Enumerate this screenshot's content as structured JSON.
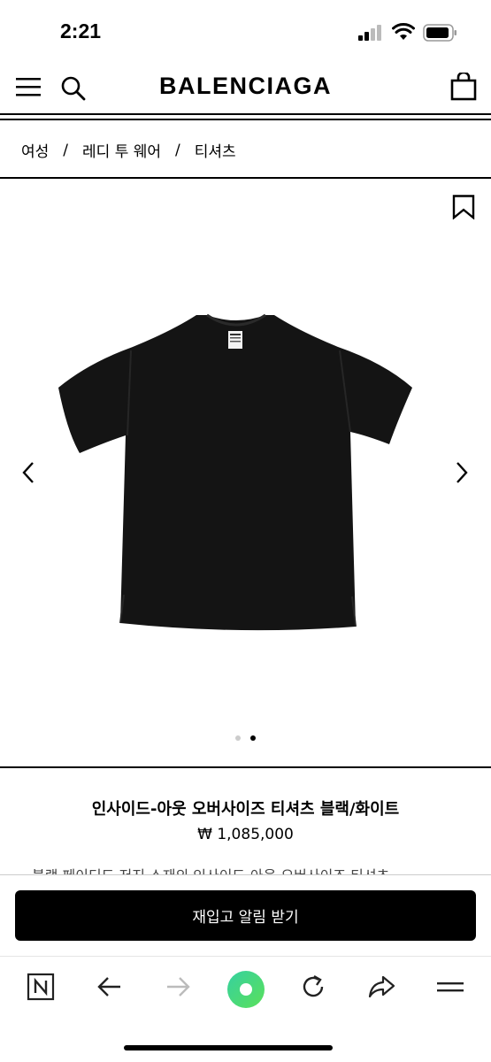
{
  "status": {
    "time": "2:21"
  },
  "header": {
    "brand": "BALENCIAGA"
  },
  "breadcrumb": {
    "items": [
      "여성",
      "레디 투 웨어",
      "티셔츠"
    ],
    "separator": "/"
  },
  "gallery": {
    "dots": 2,
    "active_dot": 2
  },
  "product": {
    "title": "인사이드-아웃 오버사이즈 티셔츠 블랙/화이트",
    "price": "₩ 1,085,000",
    "description_peek": "블랙 페이디드 저지 소재의 인사이드-아웃 오버사이즈 티셔츠"
  },
  "cta": {
    "label": "재입고 알림 받기"
  },
  "colors": {
    "accent": "#000000",
    "browser_green": "#3ddc84"
  },
  "browser": {
    "icons": [
      "naver-icon",
      "back-arrow-icon",
      "forward-arrow-icon",
      "green-dot-icon",
      "refresh-icon",
      "share-icon",
      "menu-icon"
    ]
  }
}
